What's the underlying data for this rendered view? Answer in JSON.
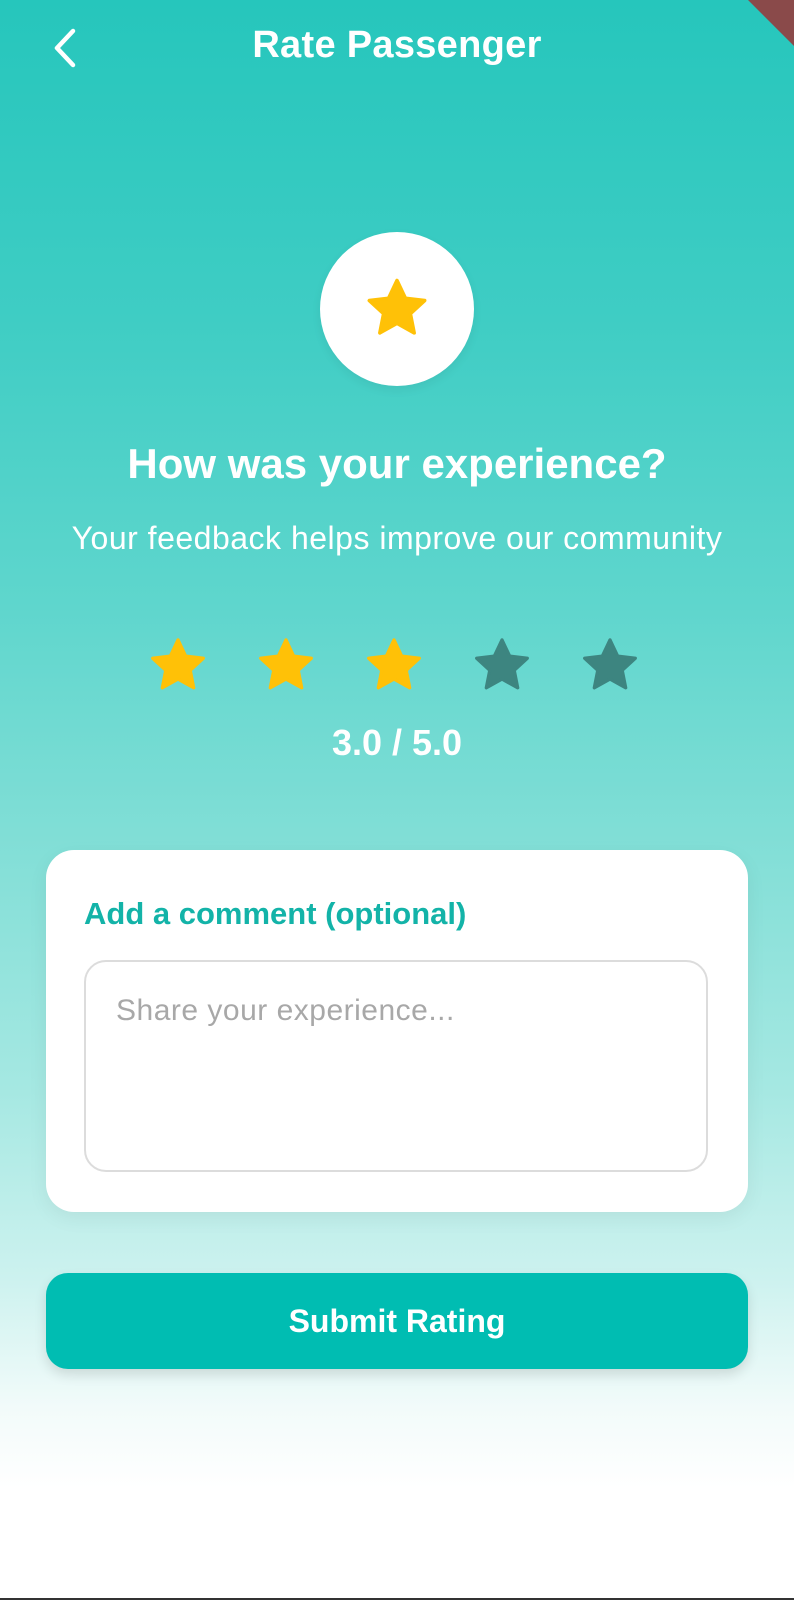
{
  "header": {
    "title": "Rate Passenger",
    "back_icon": "chevron-left-icon"
  },
  "hero": {
    "icon": "star-icon",
    "headline": "How was your experience?",
    "subline": "Your feedback helps improve our community"
  },
  "rating": {
    "value": 3,
    "max": 5,
    "display": "3.0 / 5.0",
    "filled_color": "#ffc107",
    "empty_color": "#3d8580"
  },
  "comment": {
    "label": "Add a comment (optional)",
    "placeholder": "Share your experience...",
    "value": ""
  },
  "submit": {
    "label": "Submit Rating"
  },
  "colors": {
    "accent": "#00bdb2",
    "label_accent": "#13b3a8",
    "gradient_top": "#26c6bc"
  }
}
